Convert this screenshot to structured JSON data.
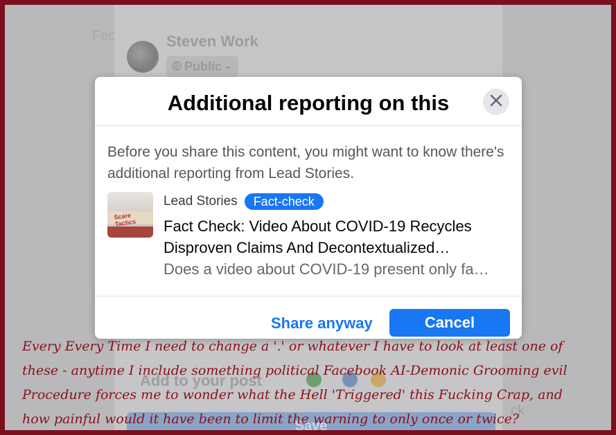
{
  "background": {
    "author_name": "Steven Work",
    "audience_label": "Public",
    "left_fragment": "Feb",
    "add_to_post": "Add to your post",
    "save_label": "Save",
    "right_fragment": "ck"
  },
  "dialog": {
    "title": "Additional reporting on this",
    "description": "Before you share this content, you might want to know there's additional reporting from Lead Stories.",
    "article": {
      "source": "Lead Stories",
      "badge": "Fact-check",
      "headline": "Fact Check: Video About COVID-19 Recycles Disproven Claims And Decontextualized…",
      "snippet": "Does a video about COVID-19 present only fa…",
      "thumbnail_text": "Scare Tactics"
    },
    "share_anyway_label": "Share anyway",
    "cancel_label": "Cancel"
  },
  "caption": {
    "line1": "Every Every Time I need to change a '.' or whatever I have to look at least one of",
    "line2": "these - anytime I include something political Facebook AI-Demonic Grooming evil",
    "line3": "Procedure forces me to wonder what the Hell 'Triggered' this Fucking Crap, and",
    "line4": "how painful would it have been to limit the warning to only once or twice?"
  },
  "colors": {
    "frame": "#7a0f1e",
    "accent": "#1877f2",
    "caption_text": "#8b0f1a"
  }
}
